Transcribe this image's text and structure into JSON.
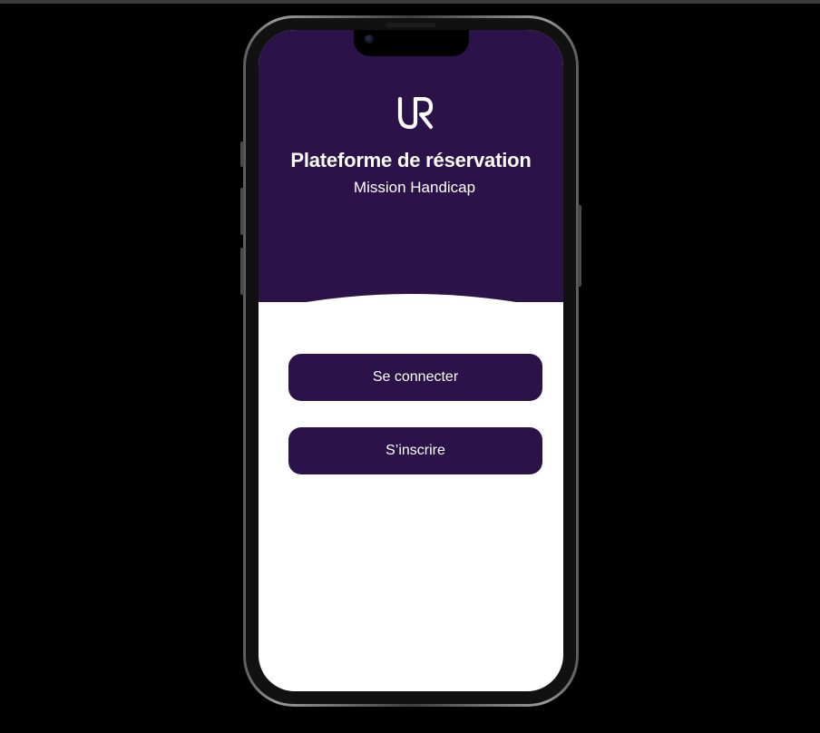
{
  "app": {
    "logo_text": "UR",
    "title": "Plateforme de réservation",
    "subtitle": "Mission Handicap"
  },
  "actions": {
    "login_label": "Se connecter",
    "signup_label": "S’inscrire"
  },
  "colors": {
    "brand_purple": "#2b1349",
    "screen_background": "#ffffff",
    "page_background": "#000000"
  }
}
